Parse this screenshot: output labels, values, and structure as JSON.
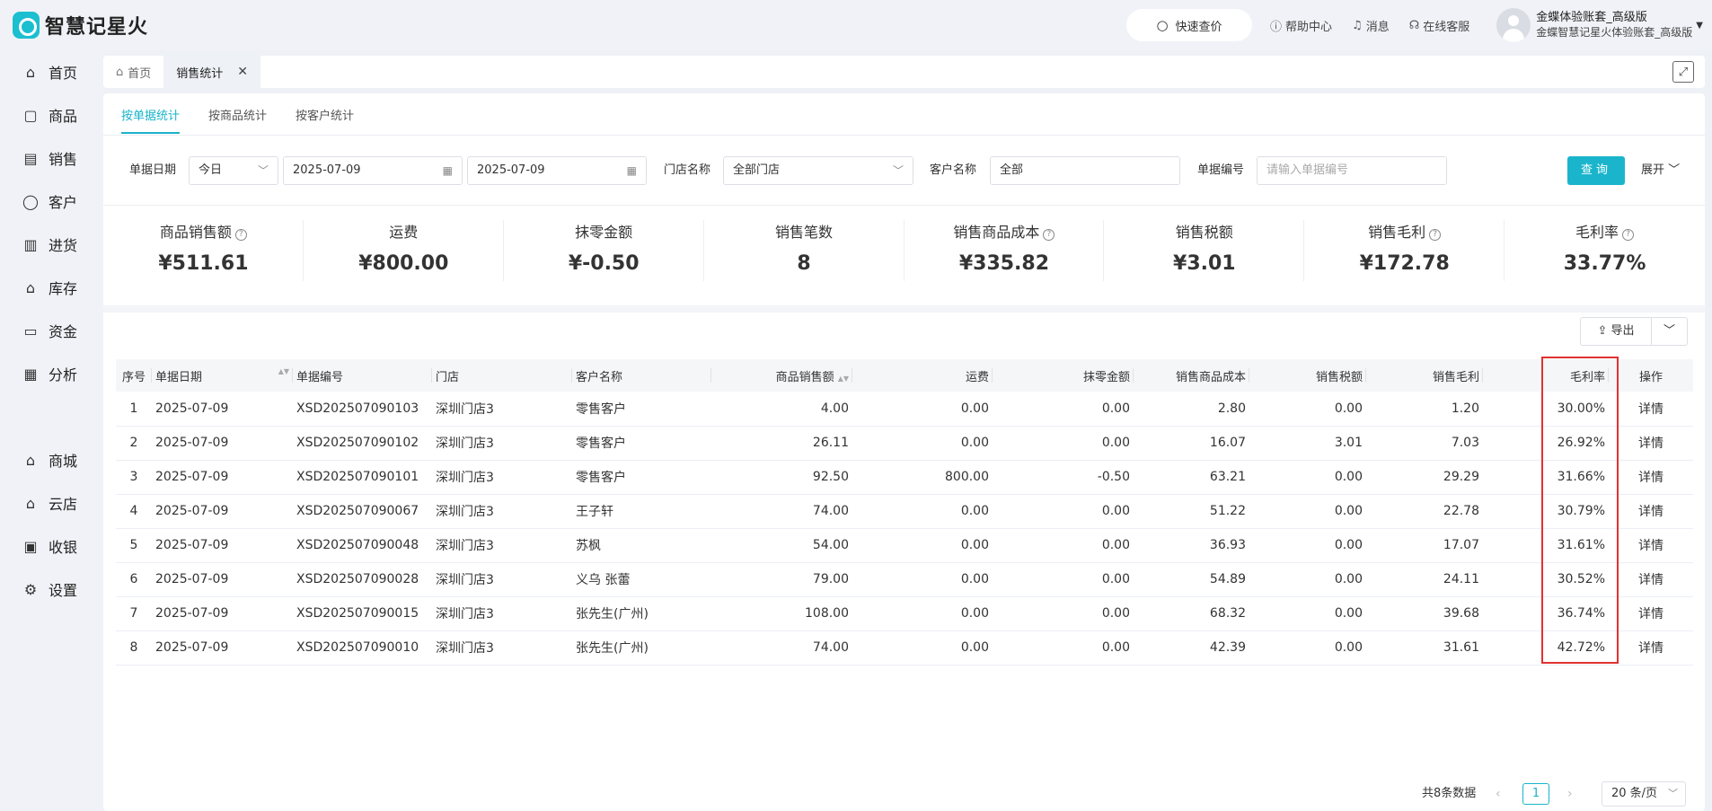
{
  "app": {
    "title": "智慧记星火"
  },
  "topbar": {
    "quick_search": "快速查价",
    "help": "帮助中心",
    "messages": "消息",
    "support": "在线客服",
    "user_name": "金蝶体验账套_高级版",
    "user_sub": "金蝶智慧记星火体验账套_高级版"
  },
  "sidebar": {
    "items": [
      {
        "label": "首页",
        "icon": "home-icon"
      },
      {
        "label": "商品",
        "icon": "bag-icon"
      },
      {
        "label": "销售",
        "icon": "document-icon"
      },
      {
        "label": "客户",
        "icon": "user-icon"
      },
      {
        "label": "进货",
        "icon": "purchase-icon"
      },
      {
        "label": "库存",
        "icon": "warehouse-icon"
      },
      {
        "label": "资金",
        "icon": "wallet-icon"
      },
      {
        "label": "分析",
        "icon": "chart-icon"
      }
    ],
    "items2": [
      {
        "label": "商城",
        "icon": "shop-icon"
      },
      {
        "label": "云店",
        "icon": "cloud-store-icon"
      },
      {
        "label": "收银",
        "icon": "cashier-icon"
      },
      {
        "label": "设置",
        "icon": "gear-icon"
      }
    ]
  },
  "tabs": {
    "home": "首页",
    "sales_stats": "销售统计"
  },
  "subtabs": [
    "按单据统计",
    "按商品统计",
    "按客户统计"
  ],
  "filters": {
    "date_label": "单据日期",
    "date_range": "今日",
    "start_date": "2025-07-09",
    "end_date": "2025-07-09",
    "store_label": "门店名称",
    "store_value": "全部门店",
    "customer_label": "客户名称",
    "customer_value": "全部",
    "order_label": "单据编号",
    "order_placeholder": "请输入单据编号",
    "query": "查询",
    "expand": "展开"
  },
  "stats": [
    {
      "label": "商品销售额",
      "value": "¥511.61",
      "help": true
    },
    {
      "label": "运费",
      "value": "¥800.00",
      "help": false
    },
    {
      "label": "抹零金额",
      "value": "¥-0.50",
      "help": false
    },
    {
      "label": "销售笔数",
      "value": "8",
      "help": false
    },
    {
      "label": "销售商品成本",
      "value": "¥335.82",
      "help": true
    },
    {
      "label": "销售税额",
      "value": "¥3.01",
      "help": false
    },
    {
      "label": "销售毛利",
      "value": "¥172.78",
      "help": true
    },
    {
      "label": "毛利率",
      "value": "33.77%",
      "help": true
    }
  ],
  "export": "导出",
  "table": {
    "headers": [
      "序号",
      "单据日期",
      "单据编号",
      "门店",
      "客户名称",
      "商品销售额",
      "运费",
      "抹零金额",
      "销售商品成本",
      "销售税额",
      "销售毛利",
      "毛利率",
      "操作"
    ],
    "action_label": "详情",
    "rows": [
      [
        "1",
        "2025-07-09",
        "XSD202507090103",
        "深圳门店3",
        "零售客户",
        "4.00",
        "0.00",
        "0.00",
        "2.80",
        "0.00",
        "1.20",
        "30.00%"
      ],
      [
        "2",
        "2025-07-09",
        "XSD202507090102",
        "深圳门店3",
        "零售客户",
        "26.11",
        "0.00",
        "0.00",
        "16.07",
        "3.01",
        "7.03",
        "26.92%"
      ],
      [
        "3",
        "2025-07-09",
        "XSD202507090101",
        "深圳门店3",
        "零售客户",
        "92.50",
        "800.00",
        "-0.50",
        "63.21",
        "0.00",
        "29.29",
        "31.66%"
      ],
      [
        "4",
        "2025-07-09",
        "XSD202507090067",
        "深圳门店3",
        "王子轩",
        "74.00",
        "0.00",
        "0.00",
        "51.22",
        "0.00",
        "22.78",
        "30.79%"
      ],
      [
        "5",
        "2025-07-09",
        "XSD202507090048",
        "深圳门店3",
        "苏枫",
        "54.00",
        "0.00",
        "0.00",
        "36.93",
        "0.00",
        "17.07",
        "31.61%"
      ],
      [
        "6",
        "2025-07-09",
        "XSD202507090028",
        "深圳门店3",
        "义乌 张蕾",
        "79.00",
        "0.00",
        "0.00",
        "54.89",
        "0.00",
        "24.11",
        "30.52%"
      ],
      [
        "7",
        "2025-07-09",
        "XSD202507090015",
        "深圳门店3",
        "张先生(广州)",
        "108.00",
        "0.00",
        "0.00",
        "68.32",
        "0.00",
        "39.68",
        "36.74%"
      ],
      [
        "8",
        "2025-07-09",
        "XSD202507090010",
        "深圳门店3",
        "张先生(广州)",
        "74.00",
        "0.00",
        "0.00",
        "42.39",
        "0.00",
        "31.61",
        "42.72%"
      ]
    ]
  },
  "pagination": {
    "total": "共8条数据",
    "current": "1",
    "page_size": "20 条/页"
  },
  "colors": {
    "accent": "#1ab5cc",
    "highlight": "#e23131"
  }
}
